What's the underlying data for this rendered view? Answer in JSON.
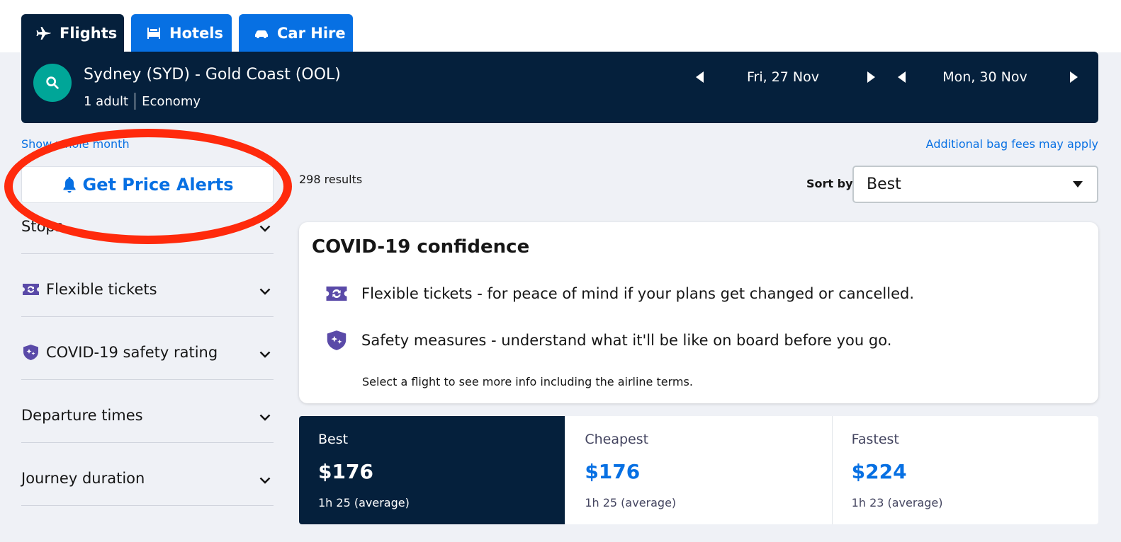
{
  "tabs": {
    "flights": "Flights",
    "hotels": "Hotels",
    "car_hire": "Car Hire"
  },
  "search": {
    "route": "Sydney (SYD) - Gold Coast (OOL)",
    "travellers": "1 adult",
    "cabin": "Economy",
    "depart_date": "Fri, 27 Nov",
    "return_date": "Mon, 30 Nov"
  },
  "links": {
    "whole_month": "Show whole month",
    "bag_fees": "Additional bag fees may apply"
  },
  "price_alerts": "Get Price Alerts",
  "results_count": "298 results",
  "sort": {
    "label": "Sort by",
    "value": "Best"
  },
  "filters": [
    {
      "label": "Stops"
    },
    {
      "label": "Flexible tickets",
      "icon": "flexible-ticket-icon"
    },
    {
      "label": "COVID-19 safety rating",
      "icon": "shield-icon"
    },
    {
      "label": "Departure times"
    },
    {
      "label": "Journey duration"
    }
  ],
  "covid": {
    "title": "COVID-19 confidence",
    "flexible": "Flexible tickets - for peace of mind if your plans get changed or cancelled.",
    "safety": "Safety measures - understand what it'll be like on board before you go.",
    "note": "Select a flight to see more info including the airline terms."
  },
  "sort_tabs": [
    {
      "name": "Best",
      "price": "$176",
      "duration": "1h 25 (average)"
    },
    {
      "name": "Cheapest",
      "price": "$176",
      "duration": "1h 25 (average)"
    },
    {
      "name": "Fastest",
      "price": "$224",
      "duration": "1h 23 (average)"
    }
  ],
  "colors": {
    "navy": "#05203c",
    "blue": "#0770e3",
    "teal": "#00a698",
    "purple": "#5a4aa8",
    "annotation_red": "#ff2a0c"
  }
}
